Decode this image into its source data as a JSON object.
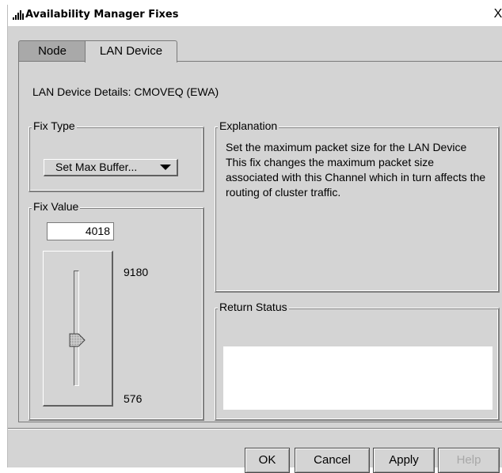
{
  "window": {
    "title": "Availability Manager Fixes",
    "close_label": "X"
  },
  "tabs": [
    {
      "label": "Node",
      "selected": false
    },
    {
      "label": "LAN Device",
      "selected": true
    }
  ],
  "details": {
    "text": "LAN Device Details: CMOVEQ (EWA)"
  },
  "fix_type": {
    "legend": "Fix Type",
    "selected": "Set Max Buffer..."
  },
  "fix_value": {
    "legend": "Fix Value",
    "value": "4018",
    "max": "9180",
    "min": "576",
    "slider_value": 4018
  },
  "explanation": {
    "legend": "Explanation",
    "line1": "Set the maximum packet size for the LAN Device",
    "line2": "This fix changes the maximum packet size associated with this Channel which in turn affects the routing of cluster traffic."
  },
  "return_status": {
    "legend": "Return Status",
    "text": ""
  },
  "buttons": {
    "ok": "OK",
    "cancel": "Cancel",
    "apply": "Apply",
    "help": "Help"
  },
  "colors": {
    "window_bg": "#d4d4d4",
    "inactive_tab": "#a9a9a9",
    "disabled_text": "#a8a8a8"
  }
}
